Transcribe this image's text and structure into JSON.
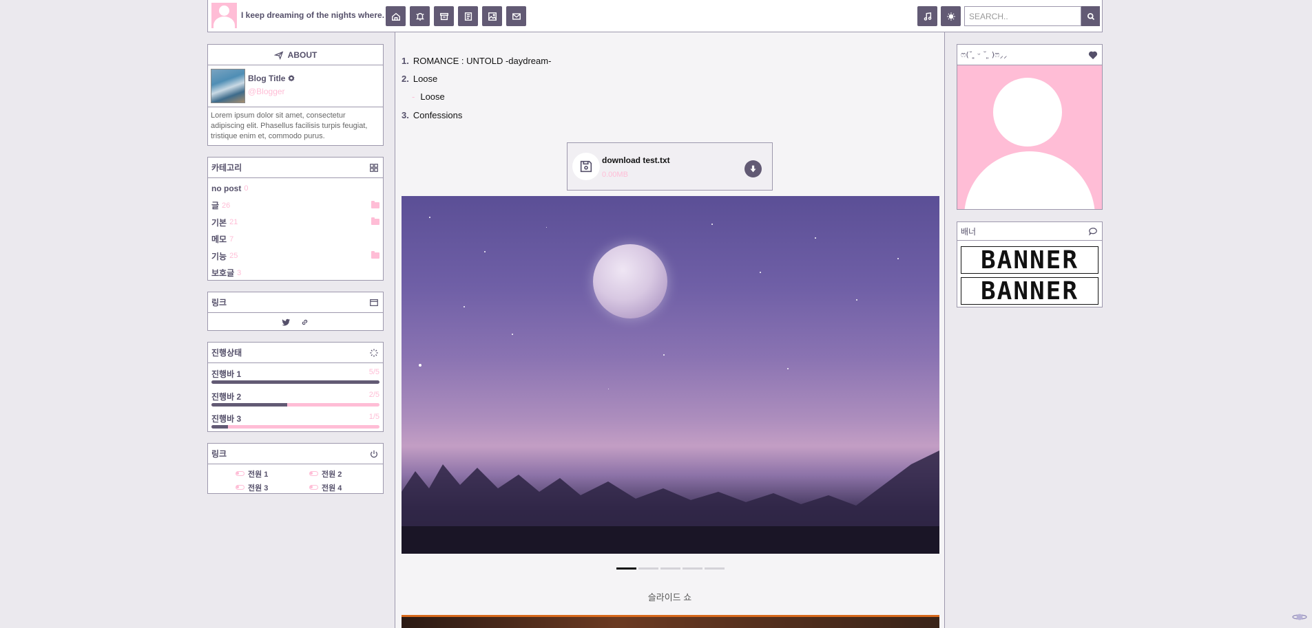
{
  "topbar": {
    "site_title": "I keep dreaming of the nights where.",
    "nav_icons": [
      "home-icon",
      "bell-icon",
      "archive-icon",
      "document-icon",
      "image-icon",
      "mail-icon"
    ],
    "right_icons": [
      "music-icon",
      "sun-icon"
    ],
    "search_placeholder": "SEARCH.."
  },
  "about": {
    "header": "ABOUT",
    "blog_title": "Blog Title",
    "blogger": "@Blogger",
    "description": "Lorem ipsum dolor sit amet, consectetur adipiscing elit. Phasellus facilisis turpis feugiat, tristique enim et, commodo purus."
  },
  "categories": {
    "header": "카테고리",
    "items": [
      {
        "label": "no post",
        "count": "0",
        "folder": false
      },
      {
        "label": "글",
        "count": "26",
        "folder": true
      },
      {
        "label": "기본",
        "count": "21",
        "folder": true
      },
      {
        "label": "메모",
        "count": "7",
        "folder": false
      },
      {
        "label": "기능",
        "count": "25",
        "folder": true
      },
      {
        "label": "보호글",
        "count": "3",
        "folder": false
      }
    ]
  },
  "links": {
    "header": "링크",
    "icons": [
      "twitter-icon",
      "link-icon"
    ]
  },
  "progress": {
    "header": "진행상태",
    "items": [
      {
        "label": "진행바 1",
        "value": "5/5",
        "fraction": 1.0
      },
      {
        "label": "진행바 2",
        "value": "2/5",
        "fraction": 0.45
      },
      {
        "label": "진행바 3",
        "value": "1/5",
        "fraction": 0.1
      }
    ]
  },
  "power": {
    "header": "링크",
    "items": [
      "전원 1",
      "전원 2",
      "전원 3",
      "전원 4"
    ]
  },
  "main": {
    "list": [
      {
        "num": "1.",
        "text": "ROMANCE : UNTOLD -daydream-"
      },
      {
        "num": "2.",
        "text": "Loose"
      },
      {
        "num": "3.",
        "text": "Confessions"
      }
    ],
    "subitem": "Loose",
    "download": {
      "name": "download test.txt",
      "size": "0.00MB"
    },
    "slide_caption": "슬라이드 쇼",
    "slide_count": 5,
    "active_slide": 1
  },
  "profile": {
    "header": "ෆ(˘ ͈ ᵕ ˘ ͈ )ෆ⸝⸝"
  },
  "banners": {
    "header": "배너",
    "items": [
      "BANNER",
      "BANNER"
    ]
  },
  "colors": {
    "accent": "#625a74",
    "pink": "#ffbdd6",
    "border": "#9c97ac",
    "background": "#ebe9ee"
  }
}
